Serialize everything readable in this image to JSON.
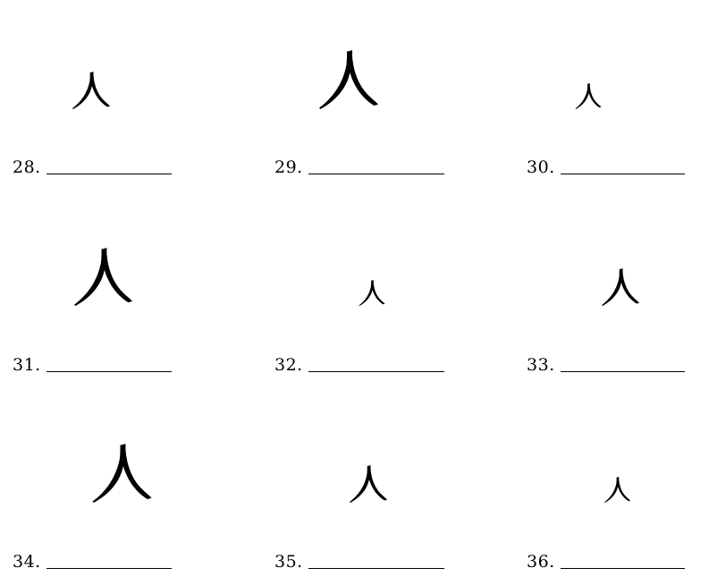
{
  "worksheet": {
    "items": [
      {
        "number": "28.",
        "character": "人"
      },
      {
        "number": "29.",
        "character": "人"
      },
      {
        "number": "30.",
        "character": "人"
      },
      {
        "number": "31.",
        "character": "人"
      },
      {
        "number": "32.",
        "character": "人"
      },
      {
        "number": "33.",
        "character": "人"
      },
      {
        "number": "34.",
        "character": "人"
      },
      {
        "number": "35.",
        "character": "人"
      },
      {
        "number": "36.",
        "character": "人"
      }
    ]
  }
}
